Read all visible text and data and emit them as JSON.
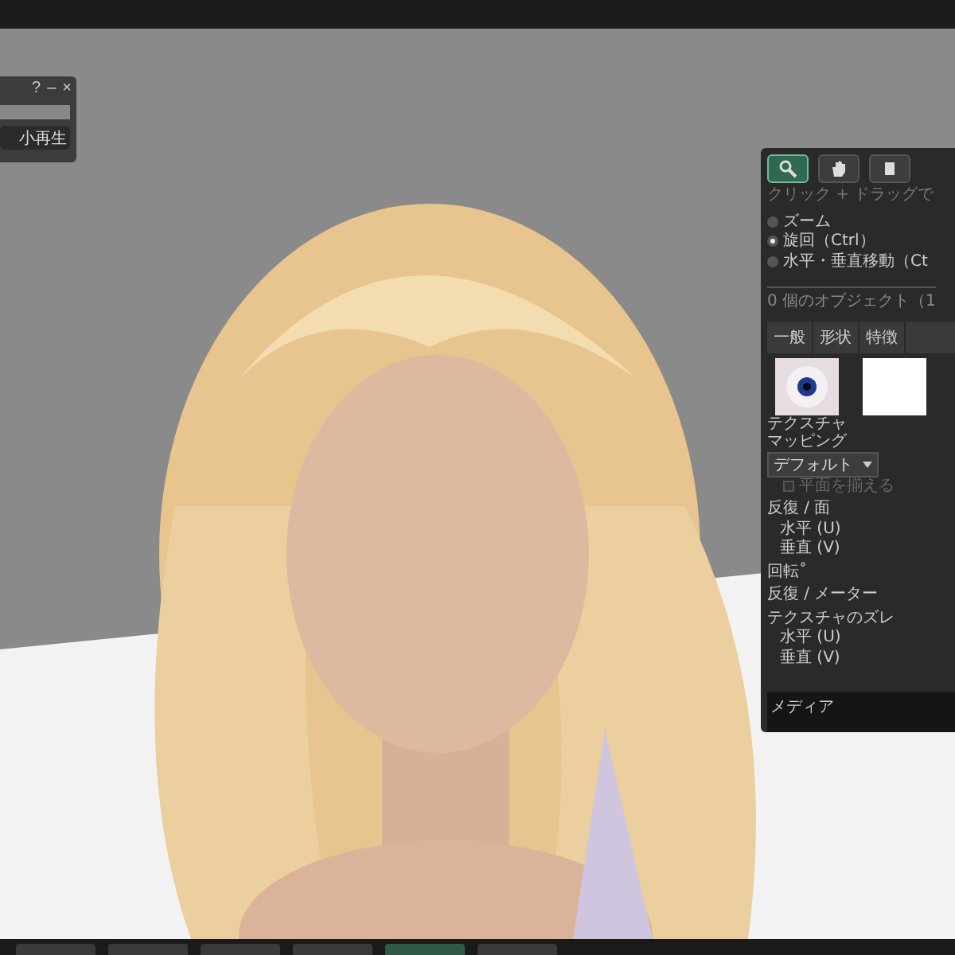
{
  "mini_panel": {
    "title_buttons": [
      "?",
      "–",
      "×"
    ],
    "button": "小再生"
  },
  "tools": {
    "buttons": [
      {
        "selected": true
      },
      {
        "selected": false
      },
      {
        "selected": false
      }
    ],
    "hint": "クリック + ドラッグで",
    "modes": [
      {
        "label": "ズーム",
        "selected": false
      },
      {
        "label": "旋回（Ctrl）",
        "selected": true
      },
      {
        "label": "水平・垂直移動（Ct",
        "selected": false
      }
    ],
    "object_count": "0 個のオブジェクト（1",
    "tabs": [
      {
        "label": "一般",
        "selected": false
      },
      {
        "label": "形状",
        "selected": false
      },
      {
        "label": "特徴",
        "selected": false
      }
    ],
    "texture_label": "テクスチャ",
    "mapping_label": "マッピング",
    "mapping_value": "デフォルト",
    "align_planar": {
      "label": "平面を揃える",
      "checked": false,
      "disabled": true
    },
    "rows": [
      {
        "kind": "header",
        "label": "反復 / 面"
      },
      {
        "kind": "sub",
        "label": "水平 (U)"
      },
      {
        "kind": "sub",
        "label": "垂直 (V)"
      },
      {
        "kind": "header",
        "label": "回転˚"
      },
      {
        "kind": "header",
        "label": "反復 / メーター"
      },
      {
        "kind": "header",
        "label": "テクスチャのズレ"
      },
      {
        "kind": "sub",
        "label": "水平 (U)"
      },
      {
        "kind": "sub",
        "label": "垂直 (V)"
      }
    ],
    "media_label": "メディア"
  }
}
